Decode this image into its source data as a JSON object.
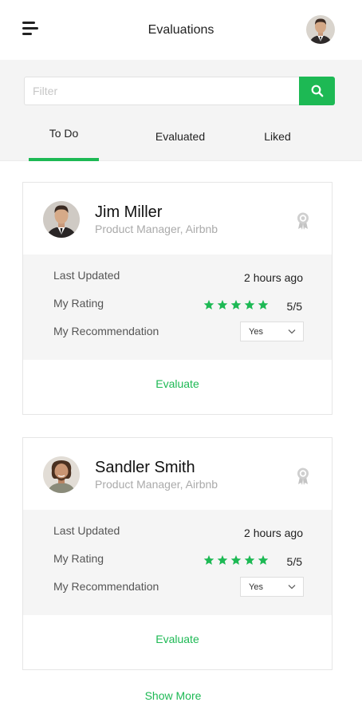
{
  "header": {
    "title": "Evaluations",
    "menu_icon": "menu-icon",
    "profile_avatar": "user-avatar"
  },
  "filter": {
    "placeholder": "Filter",
    "value": "",
    "button_icon": "search-icon"
  },
  "tabs": [
    {
      "label": "To Do",
      "active": true
    },
    {
      "label": "Evaluated",
      "active": false
    },
    {
      "label": "Liked",
      "active": false
    }
  ],
  "cards": [
    {
      "name": "Jim Miller",
      "subtitle": "Product Manager, Airbnb",
      "last_updated_label": "Last Updated",
      "last_updated_value": "2 hours ago",
      "rating_label": "My Rating",
      "rating_stars": 5,
      "rating_text": "5/5",
      "recommendation_label": "My Recommendation",
      "recommendation_value": "Yes",
      "action_label": "Evaluate",
      "badge_icon": "award-icon"
    },
    {
      "name": "Sandler Smith",
      "subtitle": "Product Manager, Airbnb",
      "last_updated_label": "Last Updated",
      "last_updated_value": "2 hours ago",
      "rating_label": "My Rating",
      "rating_stars": 5,
      "rating_text": "5/5",
      "recommendation_label": "My Recommendation",
      "recommendation_value": "Yes",
      "action_label": "Evaluate",
      "badge_icon": "award-icon"
    }
  ],
  "footer": {
    "show_more_label": "Show More"
  },
  "colors": {
    "accent": "#1db954",
    "panel": "#f5f5f5",
    "muted_text": "#aaaaaa"
  }
}
